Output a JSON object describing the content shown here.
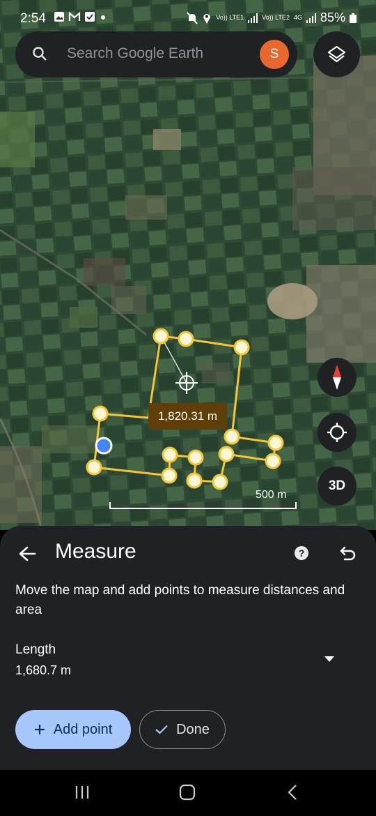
{
  "status_bar": {
    "time": "2:54",
    "sim1_label": "Vo)) LTE1",
    "sim2_label": "Vo)) LTE2",
    "network": "4G",
    "battery": "85%"
  },
  "search": {
    "placeholder": "Search Google Earth",
    "avatar_letter": "S"
  },
  "map": {
    "measurement_label": "1,820.31 m",
    "scale_label": "500 m",
    "button_3d": "3D"
  },
  "sheet": {
    "title": "Measure",
    "instructions": "Move the map and add points to measure distances and area",
    "length_label": "Length",
    "length_value": "1,680.7 m",
    "add_point_label": "Add point",
    "done_label": "Done"
  },
  "colors": {
    "accent_yellow": "#f4c534",
    "avatar": "#e8682d",
    "primary_button": "#a8c7fa",
    "sheet_bg": "#1f2124"
  }
}
